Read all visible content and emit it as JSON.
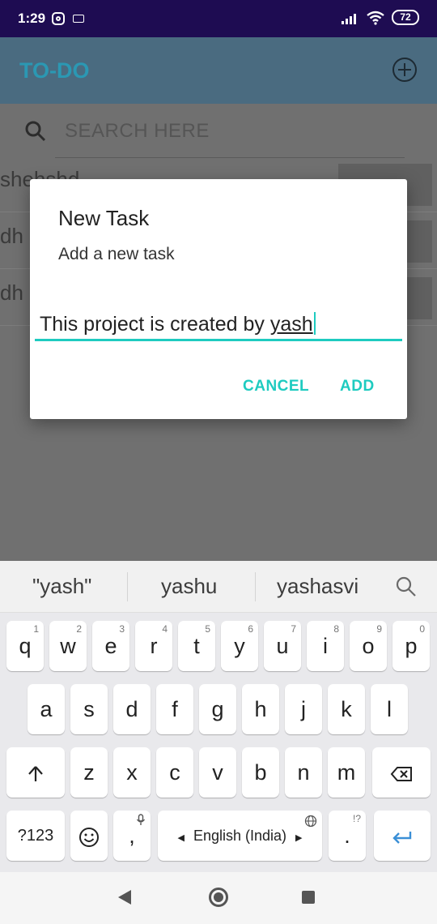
{
  "status": {
    "time": "1:29",
    "battery": "72"
  },
  "app": {
    "title": "TO-DO",
    "search_placeholder": "SEARCH HERE",
    "tasks": [
      "shehshd",
      "dh",
      "dh"
    ]
  },
  "dialog": {
    "title": "New Task",
    "message": "Add a new task",
    "input_value_prefix": "This project is created by ",
    "input_value_word": "yash",
    "cancel_label": "CANCEL",
    "add_label": "ADD",
    "accent": "#1ecbc0"
  },
  "keyboard": {
    "suggestions": [
      "\"yash\"",
      "yashu",
      "yashasvi"
    ],
    "row1": [
      "q",
      "w",
      "e",
      "r",
      "t",
      "y",
      "u",
      "i",
      "o",
      "p"
    ],
    "row1_hints": [
      "1",
      "2",
      "3",
      "4",
      "5",
      "6",
      "7",
      "8",
      "9",
      "0"
    ],
    "row2": [
      "a",
      "s",
      "d",
      "f",
      "g",
      "h",
      "j",
      "k",
      "l"
    ],
    "row3": [
      "z",
      "x",
      "c",
      "v",
      "b",
      "n",
      "m"
    ],
    "symbols_label": "?123",
    "comma_label": ",",
    "space_label": "English (India)",
    "period_label": ".",
    "period_hint": "!?"
  }
}
